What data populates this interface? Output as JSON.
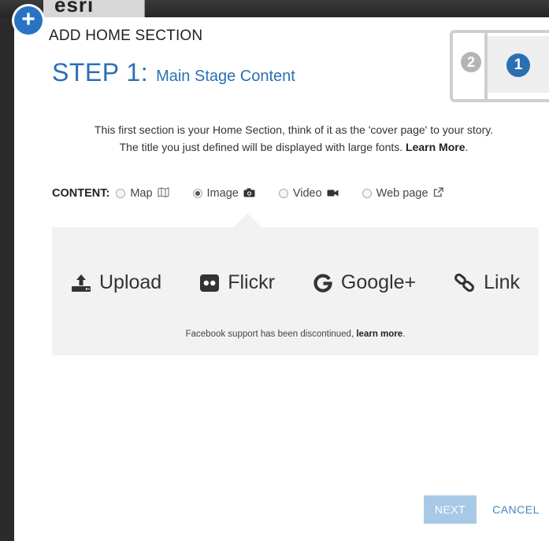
{
  "background": {
    "logo_text": "esri"
  },
  "modal": {
    "title": "ADD HOME SECTION",
    "step_label": "STEP 1:",
    "step_subtitle": "Main Stage Content",
    "step_indicator": {
      "step_two": "2",
      "step_one": "1"
    },
    "intro_line1": "This first section is your Home Section, think of it as the 'cover page' to your story.",
    "intro_line2": "The title you just defined will be displayed with large fonts.",
    "intro_learn_more": "Learn More",
    "intro_period": "."
  },
  "content": {
    "label": "CONTENT:",
    "options": [
      {
        "label": "Map",
        "icon": "map-icon",
        "selected": false
      },
      {
        "label": "Image",
        "icon": "camera-icon",
        "selected": true
      },
      {
        "label": "Video",
        "icon": "video-camera-icon",
        "selected": false
      },
      {
        "label": "Web page",
        "icon": "external-link-icon",
        "selected": false
      }
    ]
  },
  "image_sources": {
    "upload": "Upload",
    "flickr": "Flickr",
    "google": "Google+",
    "link": "Link",
    "facebook_note": "Facebook support has been discontinued,",
    "facebook_learn": "learn more",
    "facebook_period": "."
  },
  "footer": {
    "next": "NEXT",
    "cancel": "CANCEL"
  },
  "colors": {
    "accent": "#2b6fb3",
    "next_button": "#a8c9e6",
    "panel": "#f2f2f2"
  }
}
